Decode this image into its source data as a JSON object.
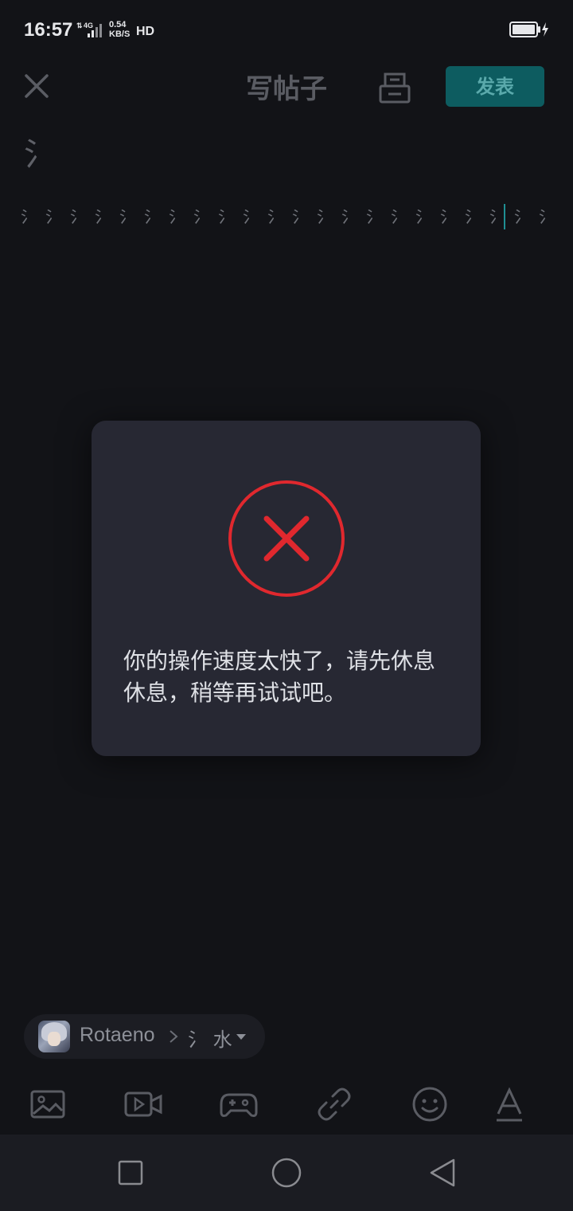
{
  "status_bar": {
    "time": "16:57",
    "network": "4G",
    "speed_value": "0.54",
    "speed_unit": "KB/S",
    "hd": "HD"
  },
  "header": {
    "title": "写帖子",
    "publish_label": "发表",
    "icons": [
      "close-icon",
      "drafts-icon"
    ]
  },
  "editor": {
    "title_value": "氵",
    "body_value": "氵氵氵氵氵氵氵氵氵氵氵氵氵氵氵氵氵氵氵氵氵氵"
  },
  "dialog": {
    "icon": "error-x-icon",
    "message": "你的操作速度太快了，请先休息休息，稍等再试试吧。"
  },
  "community_chip": {
    "community": "Rotaeno",
    "board": "氵 水"
  },
  "toolbar": {
    "tools": [
      "image-icon",
      "video-icon",
      "game-icon",
      "link-icon",
      "emoji-icon",
      "text-format-icon"
    ]
  },
  "nav_bar": {
    "buttons": [
      "recents-icon",
      "home-icon",
      "back-icon"
    ]
  },
  "colors": {
    "background": "#121317",
    "dialog": "#272833",
    "accent": "#0d5c60",
    "error": "#e0282e"
  }
}
